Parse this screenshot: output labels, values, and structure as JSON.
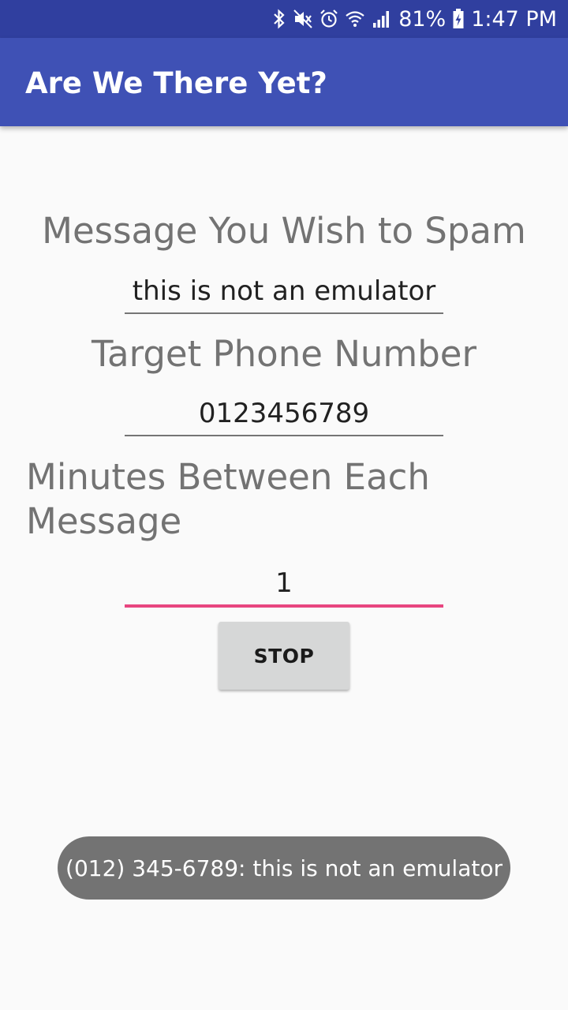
{
  "status_bar": {
    "battery_percent": "81%",
    "time": "1:47 PM",
    "icons": [
      "bluetooth-icon",
      "mute-icon",
      "alarm-icon",
      "wifi-icon",
      "signal-icon",
      "battery-charging-icon"
    ]
  },
  "app_bar": {
    "title": "Are We There Yet?",
    "color": "#3f51b5"
  },
  "form": {
    "message_label": "Message You Wish to Spam",
    "message_value": "this is not an emulator",
    "phone_label": "Target Phone Number",
    "phone_value": "0123456789",
    "minutes_label": "Minutes Between Each Message",
    "minutes_value": "1",
    "stop_label": "STOP",
    "accent_color": "#e8457f"
  },
  "toast": {
    "text": "(012) 345-6789: this is not an emulator"
  }
}
